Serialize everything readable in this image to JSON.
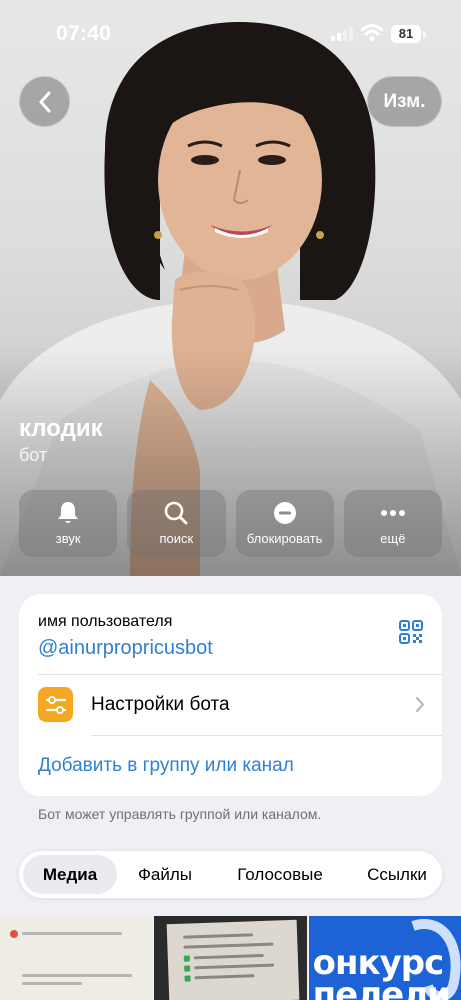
{
  "status_bar": {
    "time": "07:40",
    "battery": "81"
  },
  "header": {
    "back_icon": "chevron-left-icon",
    "edit_label": "Изм."
  },
  "profile": {
    "name": "клодик",
    "subtitle": "бот"
  },
  "actions": [
    {
      "icon": "bell-icon",
      "label": "звук"
    },
    {
      "icon": "search-icon",
      "label": "поиск"
    },
    {
      "icon": "block-icon",
      "label": "блокировать"
    },
    {
      "icon": "more-icon",
      "label": "ещё"
    }
  ],
  "info": {
    "username_label": "имя пользователя",
    "username": "@ainurpropricusbot",
    "qr_icon": "qr-code-icon",
    "bot_settings_label": "Настройки бота",
    "add_to_group_label": "Добавить в группу или канал",
    "note": "Бот может управлять группой или каналом."
  },
  "tabs": [
    {
      "label": "Медиа",
      "active": true
    },
    {
      "label": "Файлы",
      "active": false
    },
    {
      "label": "Голосовые",
      "active": false
    },
    {
      "label": "Ссылки",
      "active": false
    }
  ],
  "media": {
    "thumb3_text": [
      "онкурс",
      "пелели"
    ]
  },
  "colors": {
    "accent": "#2f7fd3",
    "bot_settings_icon_bg": "#f5a623",
    "background": "#efeff4"
  }
}
